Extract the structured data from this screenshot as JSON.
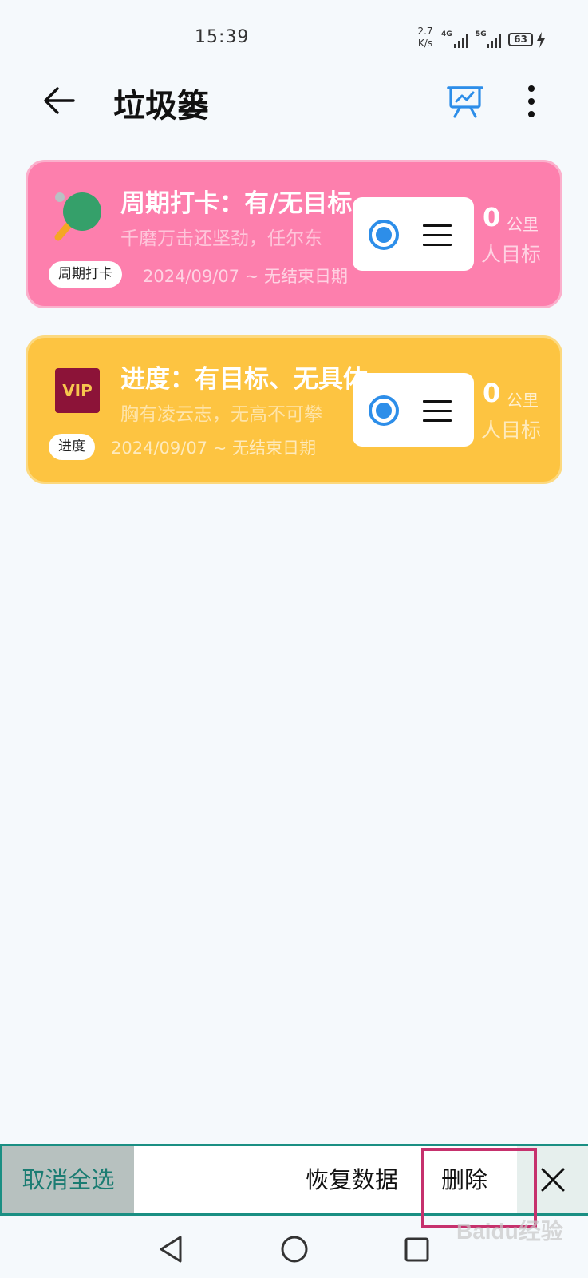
{
  "status_bar": {
    "time": "15:39",
    "speed_value": "2.7",
    "speed_unit": "K/s",
    "network1": "4G",
    "network2": "5G",
    "battery": "63"
  },
  "header": {
    "title": "垃圾篓",
    "back_icon": "arrow-left-icon",
    "stats_icon": "presentation-chart-icon",
    "more_icon": "more-vertical-icon"
  },
  "cards": [
    {
      "title": "周期打卡：有/无目标",
      "description": "千磨万击还坚劲，任尔东",
      "tag": "周期打卡",
      "date_range": "2024/09/07 ~ 无结束日期",
      "value": "0",
      "unit": "公里",
      "goal_text": "人目标",
      "icon": "ping-pong-paddle-icon",
      "color": "#fd7fad",
      "selected": true
    },
    {
      "title": "进度：有目标、无具体",
      "description": "胸有凌云志，无高不可攀",
      "tag": "进度",
      "date_range": "2024/09/07 ~ 无结束日期",
      "value": "0",
      "unit": "公里",
      "goal_text": "人目标",
      "icon": "vip-badge-icon",
      "icon_text": "VIP",
      "color": "#fdc441",
      "selected": true
    }
  ],
  "action_bar": {
    "deselect_all": "取消全选",
    "restore": "恢复数据",
    "delete": "删除",
    "close_icon": "close-icon",
    "accent": "#1a8f83",
    "highlight": "#c6316d"
  },
  "nav_bar": {
    "back": "triangle-back-icon",
    "home": "circle-home-icon",
    "recents": "square-recents-icon"
  },
  "watermark": "Baidu经验"
}
